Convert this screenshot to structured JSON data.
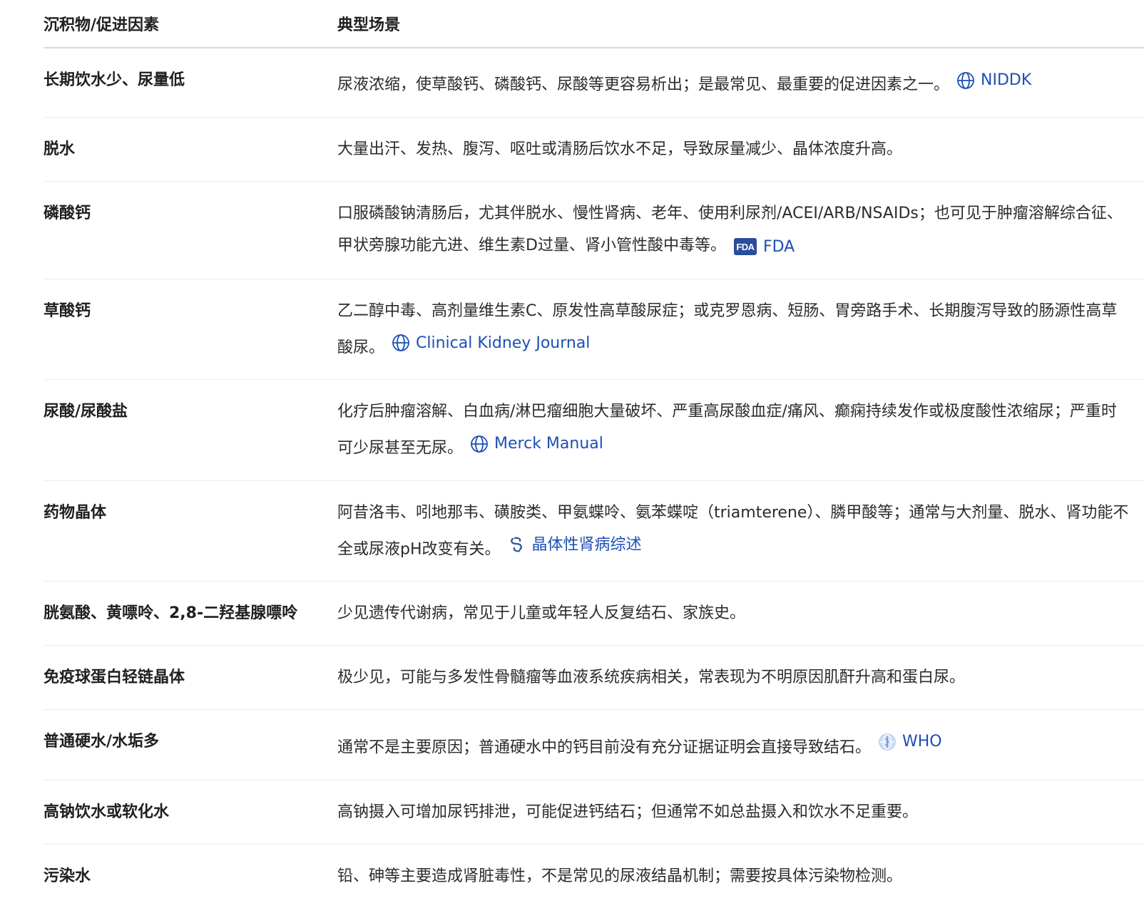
{
  "header": {
    "col1": "沉积物/促进因素",
    "col2": "典型场景"
  },
  "rows": [
    {
      "factor": "长期饮水少、尿量低",
      "scene": "尿液浓缩，使草酸钙、磷酸钙、尿酸等更容易析出；是最常见、最重要的促进因素之一。",
      "source": "NIDDK",
      "source_icon": "globe-icon"
    },
    {
      "factor": "脱水",
      "scene": "大量出汗、发热、腹泻、呕吐或清肠后饮水不足，导致尿量减少、晶体浓度升高。"
    },
    {
      "factor": "磷酸钙",
      "scene": "口服磷酸钠清肠后，尤其伴脱水、慢性肾病、老年、使用利尿剂/ACEI/ARB/NSAIDs；也可见于肿瘤溶解综合征、甲状旁腺功能亢进、维生素D过量、肾小管性酸中毒等。",
      "source": "FDA",
      "source_icon": "fda-icon",
      "source_badge": "FDA"
    },
    {
      "factor": "草酸钙",
      "scene": "乙二醇中毒、高剂量维生素C、原发性高草酸尿症；或克罗恩病、短肠、胃旁路手术、长期腹泻导致的肠源性高草酸尿。",
      "source": "Clinical Kidney Journal",
      "source_icon": "globe-icon"
    },
    {
      "factor": "尿酸/尿酸盐",
      "scene": "化疗后肿瘤溶解、白血病/淋巴瘤细胞大量破坏、严重高尿酸血症/痛风、癫痫持续发作或极度酸性浓缩尿；严重时可少尿甚至无尿。",
      "source": "Merck Manual",
      "source_icon": "globe-icon"
    },
    {
      "factor": "药物晶体",
      "scene": "阿昔洛韦、吲地那韦、磺胺类、甲氨蝶呤、氨苯蝶啶（triamterene）、膦甲酸等；通常与大剂量、脱水、肾功能不全或尿液pH改变有关。",
      "source": "晶体性肾病综述",
      "source_icon": "link-icon"
    },
    {
      "factor": "胱氨酸、黄嘌呤、2,8-二羟基腺嘌呤",
      "scene": "少见遗传代谢病，常见于儿童或年轻人反复结石、家族史。"
    },
    {
      "factor": "免疫球蛋白轻链晶体",
      "scene": "极少见，可能与多发性骨髓瘤等血液系统疾病相关，常表现为不明原因肌酐升高和蛋白尿。"
    },
    {
      "factor": "普通硬水/水垢多",
      "scene": "通常不是主要原因；普通硬水中的钙目前没有充分证据证明会直接导致结石。",
      "source": "WHO",
      "source_icon": "who-icon"
    },
    {
      "factor": "高钠饮水或软化水",
      "scene": "高钠摄入可增加尿钙排泄，可能促进钙结石；但通常不如总盐摄入和饮水不足重要。"
    },
    {
      "factor": "污染水",
      "scene": "铅、砷等主要造成肾脏毒性，不是常见的尿液结晶机制；需要按具体污染物检测。"
    }
  ],
  "colors": {
    "link": "#1b4fb5",
    "fda_badge": "#2a4d9b",
    "border": "#ececec"
  }
}
